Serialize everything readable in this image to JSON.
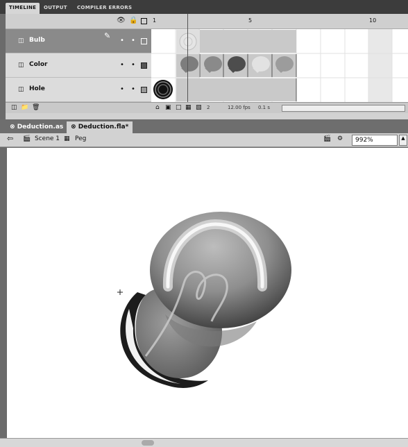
{
  "panel_tabs": [
    "TIMELINE",
    "OUTPUT",
    "COMPILER ERRORS"
  ],
  "timeline": {
    "header_icons": [
      "eye-icon",
      "lock-icon",
      "outline-icon"
    ],
    "ruler_labels": [
      "1",
      "5",
      "10"
    ],
    "layers": [
      {
        "name": "Bulb",
        "selected": true
      },
      {
        "name": "Color",
        "selected": false
      },
      {
        "name": "Hole",
        "selected": false
      }
    ],
    "footer": {
      "current_frame": "2",
      "fps": "12.00 fps",
      "time": "0.1 s"
    }
  },
  "doc_tabs": [
    "Deduction.as",
    "Deduction.fla*"
  ],
  "editbar": {
    "scene": "Scene 1",
    "symbol": "Peg",
    "zoom": "992%"
  },
  "colors": {
    "bulb_dark": "#4a4a4a",
    "bulb_mid": "#9a9a9a",
    "bulb_light": "#e8e8e8",
    "selected_layer": "#8a8a8a"
  }
}
